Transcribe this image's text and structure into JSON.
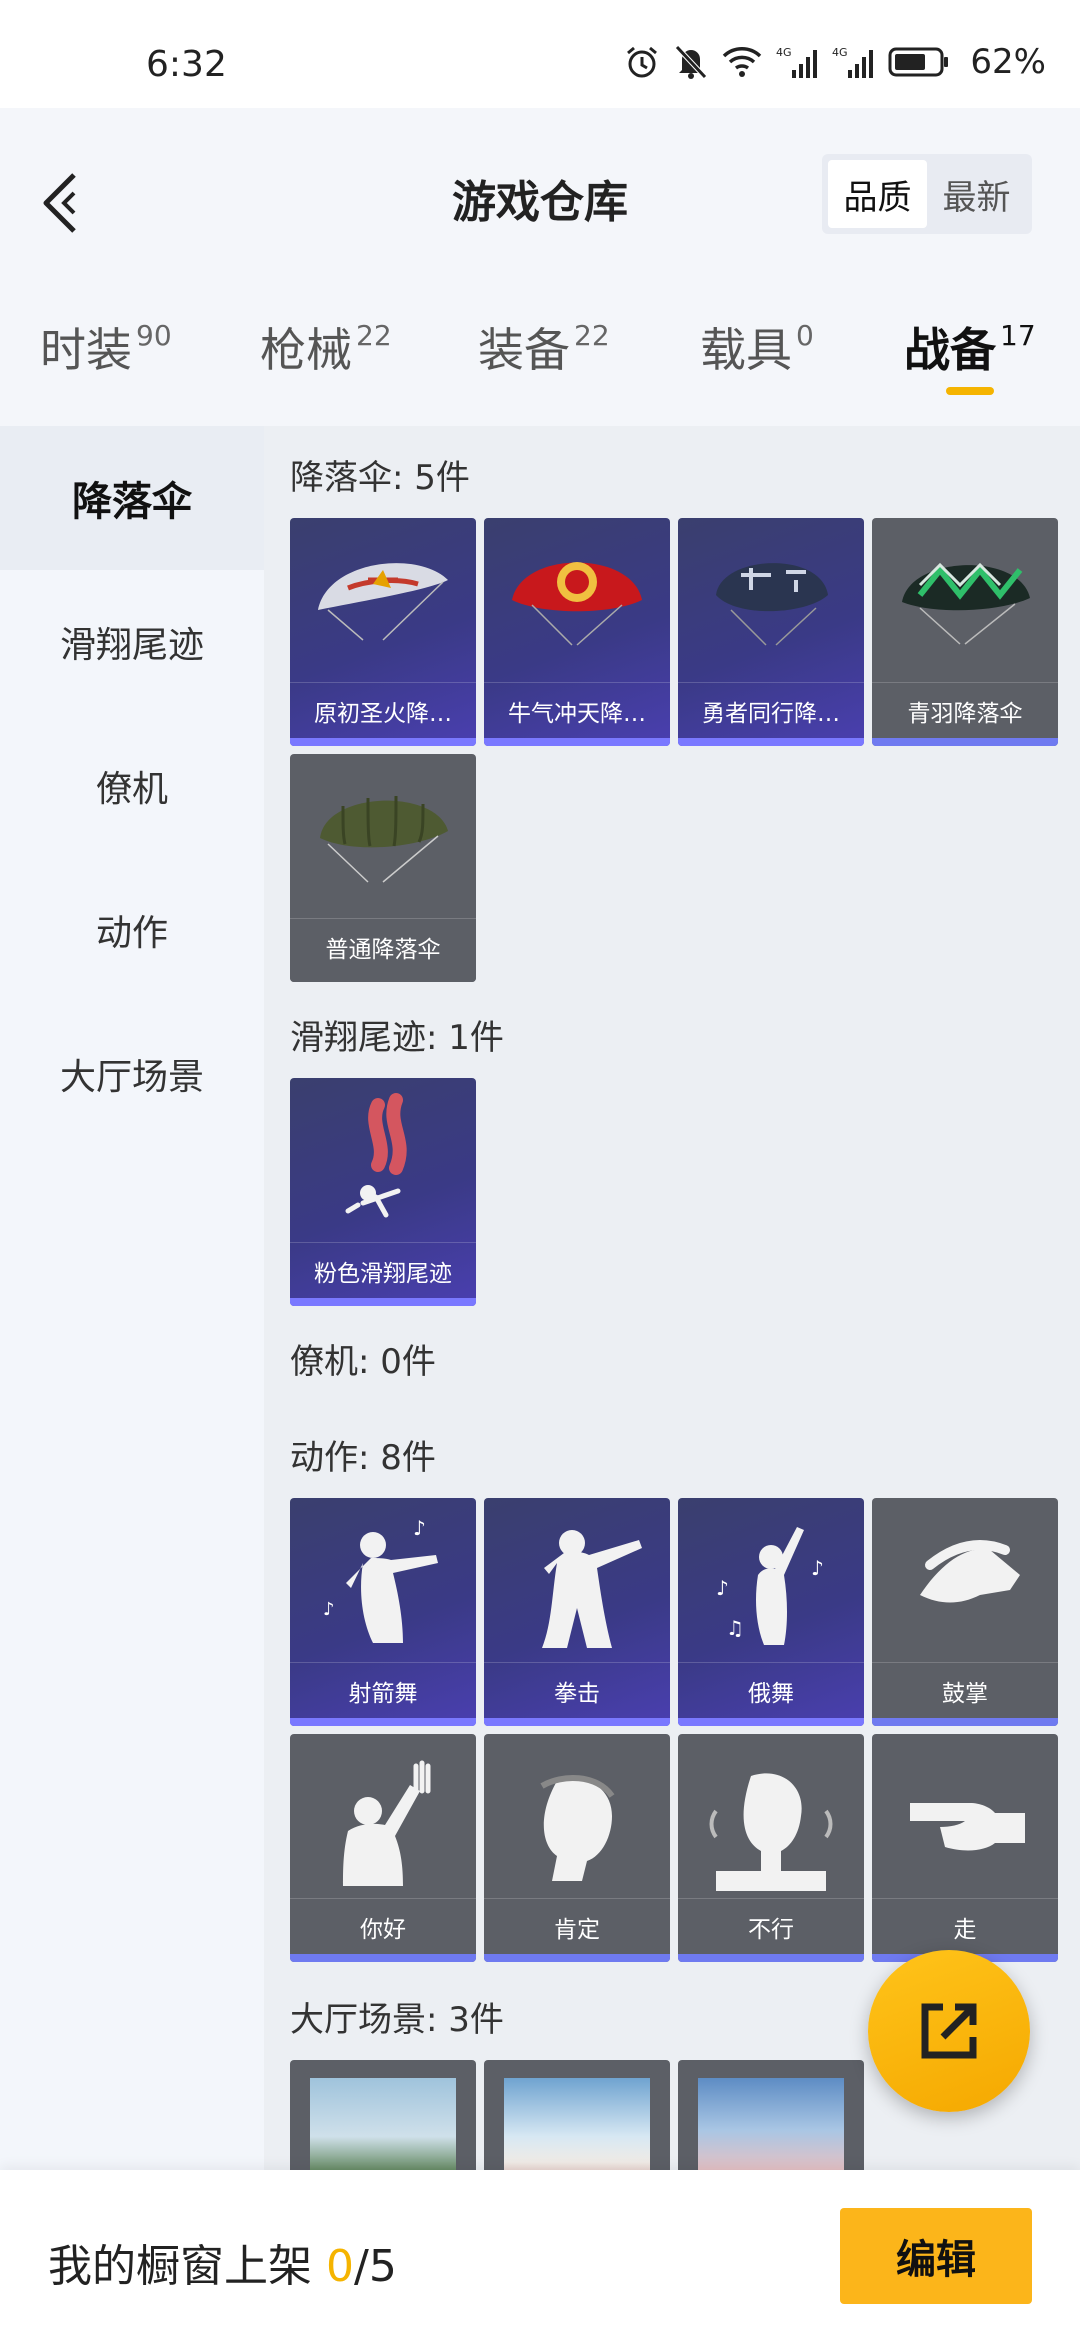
{
  "status": {
    "time": "6:32",
    "battery": "62%",
    "icons": [
      "alarm-icon",
      "mute-bell-icon",
      "wifi-icon",
      "signal-4g-icon",
      "signal-4g-icon",
      "battery-icon"
    ]
  },
  "header": {
    "title": "游戏仓库",
    "sort": {
      "quality": "品质",
      "latest": "最新",
      "active": "品质"
    }
  },
  "tabs": [
    {
      "label": "时装",
      "count": "90"
    },
    {
      "label": "枪械",
      "count": "22"
    },
    {
      "label": "装备",
      "count": "22"
    },
    {
      "label": "载具",
      "count": "0"
    },
    {
      "label": "战备",
      "count": "17",
      "active": true
    }
  ],
  "sidebar": {
    "items": [
      {
        "label": "降落伞",
        "active": true
      },
      {
        "label": "滑翔尾迹"
      },
      {
        "label": "僚机"
      },
      {
        "label": "动作"
      },
      {
        "label": "大厅场景"
      }
    ]
  },
  "sections": {
    "parachute": {
      "title": "降落伞: 5件",
      "items": [
        "原初圣火降…",
        "牛气冲天降…",
        "勇者同行降…",
        "青羽降落伞",
        "普通降落伞"
      ]
    },
    "trail": {
      "title": "滑翔尾迹: 1件",
      "items": [
        "粉色滑翔尾迹"
      ]
    },
    "wingman": {
      "title": "僚机: 0件"
    },
    "emote": {
      "title": "动作: 8件",
      "items": [
        "射箭舞",
        "拳击",
        "俄舞",
        "鼓掌",
        "你好",
        "肯定",
        "不行",
        "走"
      ]
    },
    "lobby": {
      "title": "大厅场景: 3件"
    }
  },
  "bottom": {
    "showcase_label": "我的橱窗上架 ",
    "showcase_current": "0",
    "showcase_total": "/5",
    "edit_label": "编辑"
  },
  "colors": {
    "accent": "#f5b400",
    "card_purple": "#3a3a86",
    "card_gray": "#5c5f66",
    "rarity_bar": "#7a78ff"
  }
}
